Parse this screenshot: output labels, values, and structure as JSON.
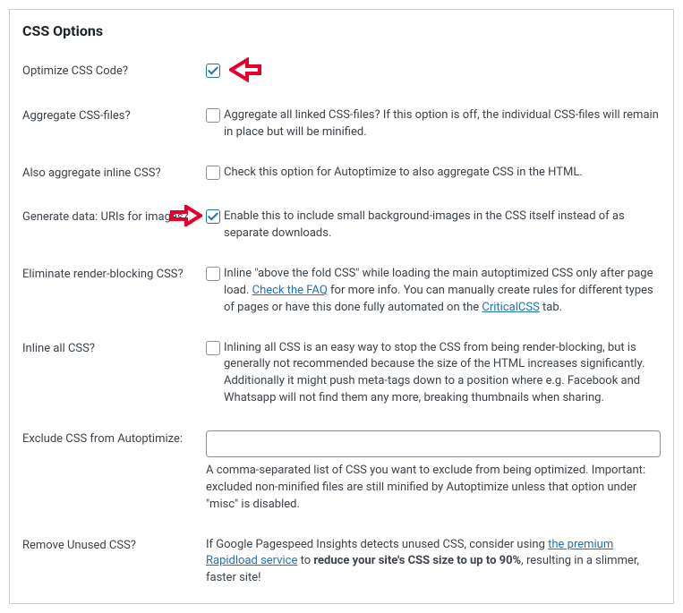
{
  "section_title": "CSS Options",
  "rows": {
    "optimize": {
      "label": "Optimize CSS Code?",
      "checked": true
    },
    "aggregate": {
      "label": "Aggregate CSS-files?",
      "checked": false,
      "desc": "Aggregate all linked CSS-files? If this option is off, the individual CSS-files will remain in place but will be minified."
    },
    "inlinecss": {
      "label": "Also aggregate inline CSS?",
      "checked": false,
      "desc": "Check this option for Autoptimize to also aggregate CSS in the HTML."
    },
    "datauri": {
      "label": "Generate data: URIs for images?",
      "checked": true,
      "desc": "Enable this to include small background-images in the CSS itself instead of as separate downloads."
    },
    "eliminate": {
      "label": "Eliminate render-blocking CSS?",
      "checked": false,
      "desc_pre": "Inline \"above the fold CSS\" while loading the main autoptimized CSS only after page load. ",
      "link1_text": "Check the FAQ",
      "desc_mid": " for more info. You can manually create rules for different types of pages or have this done fully automated on the ",
      "link2_text": "CriticalCSS",
      "desc_post": " tab."
    },
    "inlineall": {
      "label": "Inline all CSS?",
      "checked": false,
      "desc": "Inlining all CSS is an easy way to stop the CSS from being render-blocking, but is generally not recommended because the size of the HTML increases significantly. Additionally it might push meta-tags down to a position where e.g. Facebook and Whatsapp will not find them any more, breaking thumbnails when sharing."
    },
    "exclude": {
      "label": "Exclude CSS from Autoptimize:",
      "value": "",
      "help": "A comma-separated list of CSS you want to exclude from being optimized. Important: excluded non-minified files are still minified by Autoptimize unless that option under \"misc\" is disabled."
    },
    "remove": {
      "label": "Remove Unused CSS?",
      "desc_pre": "If Google Pagespeed Insights detects unused CSS, consider using ",
      "link_text": "the premium Rapidload service",
      "desc_mid": " to ",
      "bold": "reduce your site's CSS size to up to 90%",
      "desc_post": ", resulting in a slimmer, faster site!"
    }
  }
}
